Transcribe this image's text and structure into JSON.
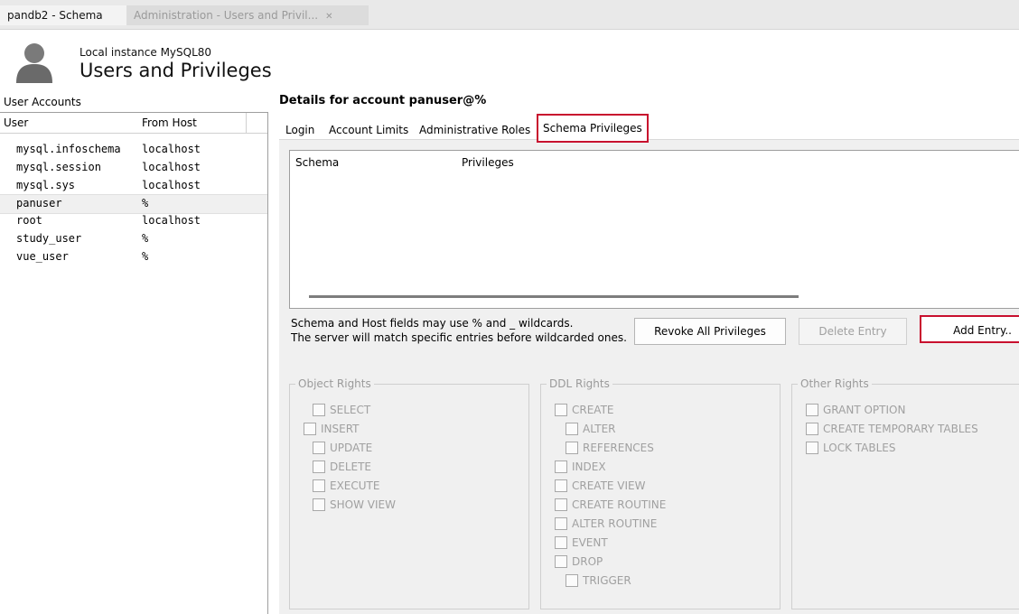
{
  "tabs": [
    {
      "label": "pandb2 - Schema",
      "active": false
    },
    {
      "label": "Administration - Users and Privil...",
      "active": true
    }
  ],
  "header": {
    "instance": "Local instance MySQL80",
    "title": "Users and Privileges"
  },
  "accounts": {
    "label": "User Accounts",
    "columns": [
      "User",
      "From Host"
    ],
    "rows": [
      {
        "user": "mysql.infoschema",
        "host": "localhost"
      },
      {
        "user": "mysql.session",
        "host": "localhost"
      },
      {
        "user": "mysql.sys",
        "host": "localhost"
      },
      {
        "user": "panuser",
        "host": "%",
        "selected": true
      },
      {
        "user": "root",
        "host": "localhost"
      },
      {
        "user": "study_user",
        "host": "%"
      },
      {
        "user": "vue_user",
        "host": "%"
      }
    ]
  },
  "details": {
    "title": "Details for account panuser@%",
    "tabs": [
      "Login",
      "Account Limits",
      "Administrative Roles",
      "Schema Privileges"
    ],
    "active_tab": "Schema Privileges",
    "table_columns": [
      "Schema",
      "Privileges"
    ],
    "note_line1": "Schema and Host fields may use % and _ wildcards.",
    "note_line2": "The server will match specific entries before wildcarded ones.",
    "buttons": {
      "revoke": "Revoke All Privileges",
      "delete": "Delete Entry",
      "add": "Add Entry.."
    }
  },
  "rights": {
    "object": {
      "legend": "Object Rights",
      "items": [
        "SELECT",
        "INSERT",
        "UPDATE",
        "DELETE",
        "EXECUTE",
        "SHOW VIEW"
      ]
    },
    "ddl": {
      "legend": "DDL Rights",
      "items": [
        "CREATE",
        "ALTER",
        "REFERENCES",
        "INDEX",
        "CREATE VIEW",
        "CREATE ROUTINE",
        "ALTER ROUTINE",
        "EVENT",
        "DROP",
        "TRIGGER"
      ]
    },
    "other": {
      "legend": "Other Rights",
      "items": [
        "GRANT OPTION",
        "CREATE TEMPORARY TABLES",
        "LOCK TABLES"
      ]
    }
  },
  "colors": {
    "highlight": "#c8102e",
    "disabled_text": "#a0a0a0"
  }
}
